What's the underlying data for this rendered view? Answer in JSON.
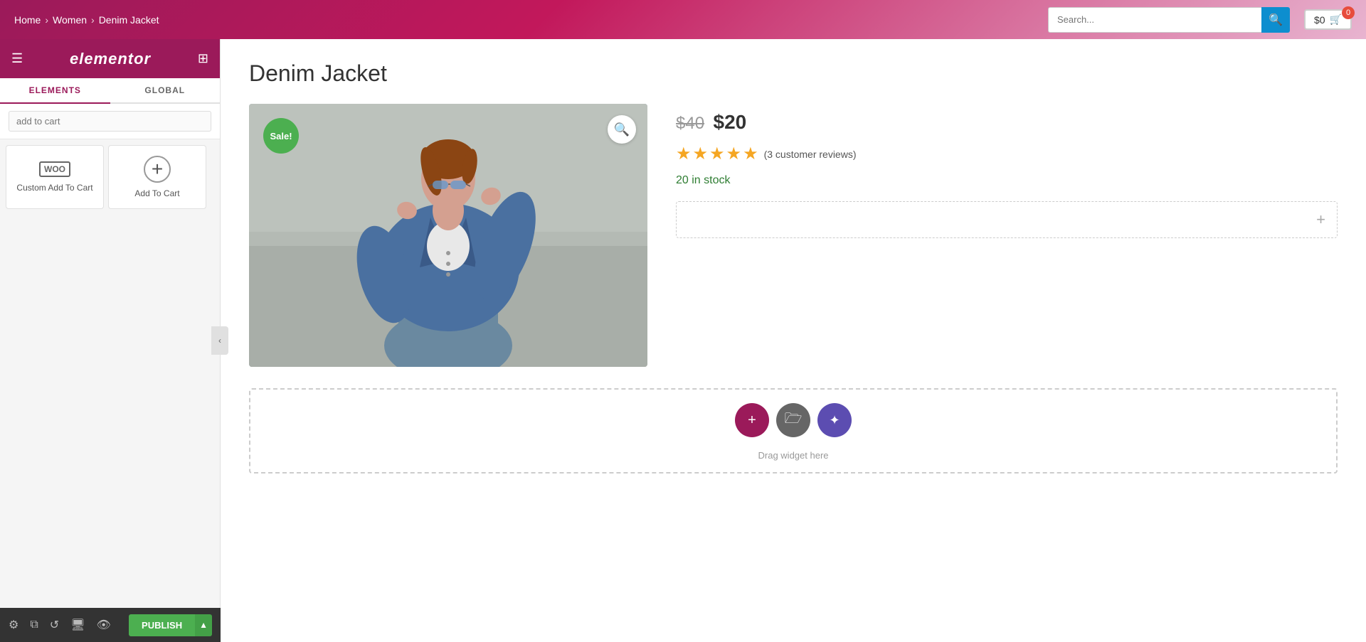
{
  "topnav": {
    "breadcrumbs": [
      {
        "label": "Home",
        "href": "#"
      },
      {
        "label": "Women",
        "href": "#"
      },
      {
        "label": "Denim Jacket",
        "href": "#"
      }
    ],
    "search_placeholder": "Search...",
    "cart_amount": "$0",
    "cart_count": "0"
  },
  "sidebar": {
    "logo": "elementor",
    "tabs": [
      {
        "label": "ELEMENTS",
        "active": true
      },
      {
        "label": "GLOBAL",
        "active": false
      }
    ],
    "search_placeholder": "add to cart",
    "widgets": [
      {
        "id": "custom-add-to-cart",
        "icon_type": "woo",
        "icon_text": "WOO",
        "label": "Custom Add To Cart"
      },
      {
        "id": "add-to-cart",
        "icon_type": "circle-plus",
        "icon_text": "⊕",
        "label": "Add To Cart"
      }
    ],
    "toolbar_icons": [
      "settings",
      "layers",
      "history",
      "desktop",
      "eye"
    ],
    "publish_label": "PUBLISH"
  },
  "product": {
    "title": "Denim Jacket",
    "sale_badge": "Sale!",
    "price_original": "$40",
    "price_current": "$20",
    "rating_stars": "★★★★★",
    "rating_text": "(3 customer reviews)",
    "stock": "20 in stock",
    "add_to_cart_placeholder": "+",
    "drag_hint": "Drag widget here"
  },
  "drop_zone": {
    "drag_hint": "Drag widget here",
    "btn_add_icon": "+",
    "btn_folder_icon": "🗁",
    "btn_elementor_icon": "✦"
  }
}
